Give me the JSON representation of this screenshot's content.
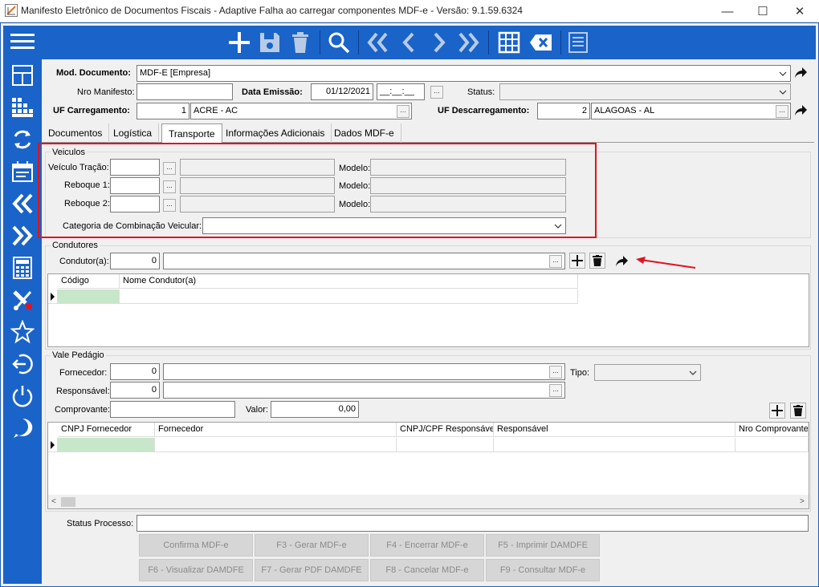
{
  "window": {
    "title": "Manifesto Eletrônico de Documentos Fiscais  -  Adaptive  Falha ao carregar componentes MDF-e - Versão: 9.1.59.6324",
    "minimize": "—",
    "maximize": "☐",
    "close": "✕"
  },
  "header": {
    "mod_documento_label": "Mod. Documento:",
    "mod_documento_value": "MDF-E [Empresa]",
    "nro_manifesto_label": "Nro Manifesto:",
    "nro_manifesto_value": "",
    "data_emissao_label": "Data Emissão:",
    "data_emissao_value": "01/12/2021",
    "hora_value": "__:__:__",
    "status_label": "Status:",
    "status_value": "",
    "uf_carregamento_label": "UF Carregamento:",
    "uf_carregamento_code": "1",
    "uf_carregamento_name": "ACRE - AC",
    "uf_descarregamento_label": "UF Descarregamento:",
    "uf_descarregamento_code": "2",
    "uf_descarregamento_name": "ALAGOAS - AL",
    "ellipsis": "..."
  },
  "tabs": [
    "Documentos",
    "Logística",
    "Transporte",
    "Informações Adicionais",
    "Dados MDF-e"
  ],
  "veiculos": {
    "title": "Veiculos",
    "tracao_label": "Veículo Tração:",
    "reboque1_label": "Reboque 1:",
    "reboque2_label": "Reboque 2:",
    "modelo_label": "Modelo:",
    "categoria_label": "Categoria de Combinação Veicular:"
  },
  "condutores": {
    "title": "Condutores",
    "condutor_label": "Condutor(a):",
    "condutor_code": "0",
    "columns": [
      "Código",
      "Nome Condutor(a)"
    ]
  },
  "vale_pedagio": {
    "title": "Vale Pedágio",
    "fornecedor_label": "Fornecedor:",
    "fornecedor_code": "0",
    "tipo_label": "Tipo:",
    "responsavel_label": "Responsável:",
    "responsavel_code": "0",
    "comprovante_label": "Comprovante:",
    "valor_label": "Valor:",
    "valor_value": "0,00",
    "columns": [
      "CNPJ Fornecedor",
      "Fornecedor",
      "CNPJ/CPF Responsável",
      "Responsável",
      "Nro Comprovante"
    ]
  },
  "status_processo_label": "Status Processo:",
  "actions": [
    "Confirma MDF-e",
    "F3 - Gerar MDF-e",
    "F4 - Encerrar MDF-e",
    "F5 - Imprimir DAMDFE",
    "F6 - Visualizar DAMDFE",
    "F7 - Gerar PDF DAMDFE",
    "F8 - Cancelar MDF-e",
    "F9 - Consultar MDF-e"
  ],
  "colors": {
    "brand": "#1a63c8",
    "highlight": "#e0141e",
    "selected_cell": "#c8e6c9"
  }
}
